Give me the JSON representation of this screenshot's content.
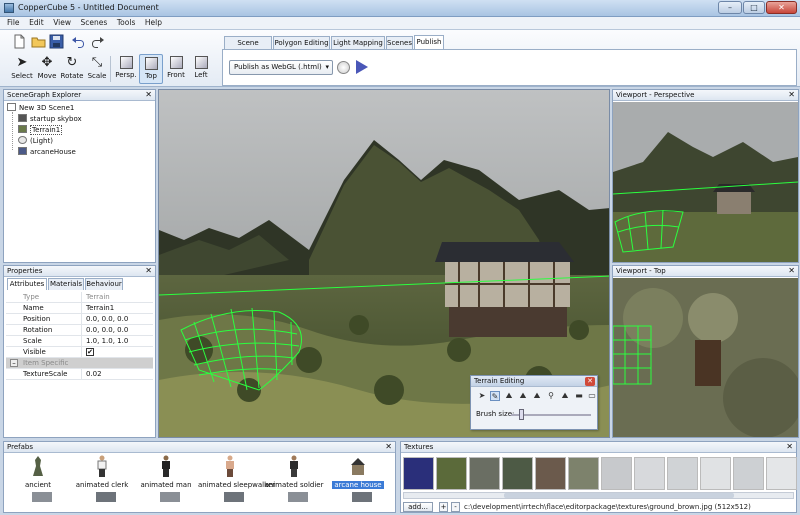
{
  "window": {
    "title": "CopperCube 5 - Untitled Document",
    "min": "–",
    "max": "□",
    "close": "✕"
  },
  "menu": [
    "File",
    "Edit",
    "View",
    "Scenes",
    "Tools",
    "Help"
  ],
  "tools": [
    {
      "label": "Select",
      "icon": "cursor-arrow-icon"
    },
    {
      "label": "Move",
      "icon": "move-arrows-icon"
    },
    {
      "label": "Rotate",
      "icon": "rotate-icon"
    },
    {
      "label": "Scale",
      "icon": "scale-icon"
    }
  ],
  "views": [
    "Persp.",
    "Top",
    "Front",
    "Left"
  ],
  "tabs": [
    "Scene Editing",
    "Polygon Editing",
    "Light Mapping",
    "Scenes",
    "Publish"
  ],
  "publish": {
    "target": "Publish as WebGL (.html)"
  },
  "scenegraph": {
    "title": "SceneGraph Explorer",
    "close": "✕",
    "root": "New 3D Scene1",
    "items": [
      "startup skybox",
      "Terrain1",
      "(Light)",
      "arcaneHouse"
    ]
  },
  "properties": {
    "title": "Properties",
    "close": "✕",
    "tabs": [
      "Attributes",
      "Materials",
      "Behaviour"
    ],
    "rows": [
      {
        "k": "Type",
        "v": "Terrain"
      },
      {
        "k": "Name",
        "v": "Terrain1"
      },
      {
        "k": "Position",
        "v": "0.0, 0.0, 0.0"
      },
      {
        "k": "Rotation",
        "v": "0.0, 0.0, 0.0"
      },
      {
        "k": "Scale",
        "v": "1.0, 1.0, 1.0"
      },
      {
        "k": "Visible",
        "v": "✔"
      },
      {
        "k": "Item Specific",
        "v": ""
      },
      {
        "k": "TextureScale",
        "v": "0.02"
      }
    ]
  },
  "viewports": {
    "perspective": "Viewport - Perspective",
    "top": "Viewport - Top",
    "close": "✕"
  },
  "terrain_editing": {
    "title": "Terrain Editing",
    "close": "✕",
    "brush_label": "Brush size:",
    "brush_size": 0.1
  },
  "prefabs": {
    "title": "Prefabs",
    "close": "✕",
    "items": [
      "ancient",
      "animated clerk",
      "animated man",
      "animated sleepwalker",
      "animated soldier",
      "arcane house"
    ]
  },
  "textures": {
    "title": "Textures",
    "close": "✕",
    "add": "add...",
    "plus": "+",
    "minus": "-",
    "path": "c:\\development\\irrtech\\flace\\editorpackage\\textures\\ground_brown.jpg (512x512)"
  },
  "colors": {
    "accent": "#3b7bd6",
    "grid": "#2bff3f",
    "chrome": "#c9d6e6"
  }
}
